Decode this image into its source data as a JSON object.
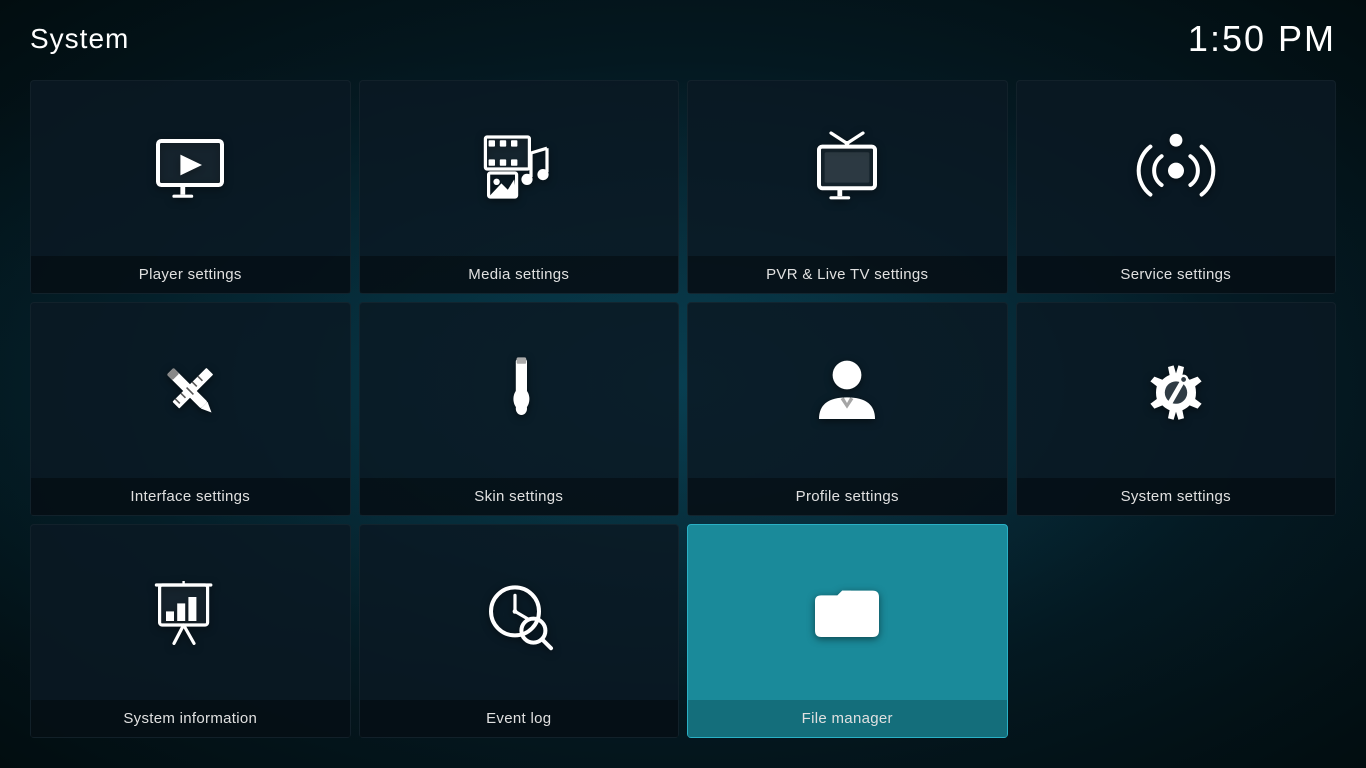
{
  "header": {
    "title": "System",
    "time": "1:50 PM"
  },
  "grid": {
    "items": [
      {
        "id": "player-settings",
        "label": "Player settings",
        "icon": "player",
        "active": false
      },
      {
        "id": "media-settings",
        "label": "Media settings",
        "icon": "media",
        "active": false
      },
      {
        "id": "pvr-settings",
        "label": "PVR & Live TV settings",
        "icon": "pvr",
        "active": false
      },
      {
        "id": "service-settings",
        "label": "Service settings",
        "icon": "service",
        "active": false
      },
      {
        "id": "interface-settings",
        "label": "Interface settings",
        "icon": "interface",
        "active": false
      },
      {
        "id": "skin-settings",
        "label": "Skin settings",
        "icon": "skin",
        "active": false
      },
      {
        "id": "profile-settings",
        "label": "Profile settings",
        "icon": "profile",
        "active": false
      },
      {
        "id": "system-settings",
        "label": "System settings",
        "icon": "system",
        "active": false
      },
      {
        "id": "system-information",
        "label": "System information",
        "icon": "sysinfo",
        "active": false
      },
      {
        "id": "event-log",
        "label": "Event log",
        "icon": "eventlog",
        "active": false
      },
      {
        "id": "file-manager",
        "label": "File manager",
        "icon": "filemanager",
        "active": true
      }
    ]
  }
}
